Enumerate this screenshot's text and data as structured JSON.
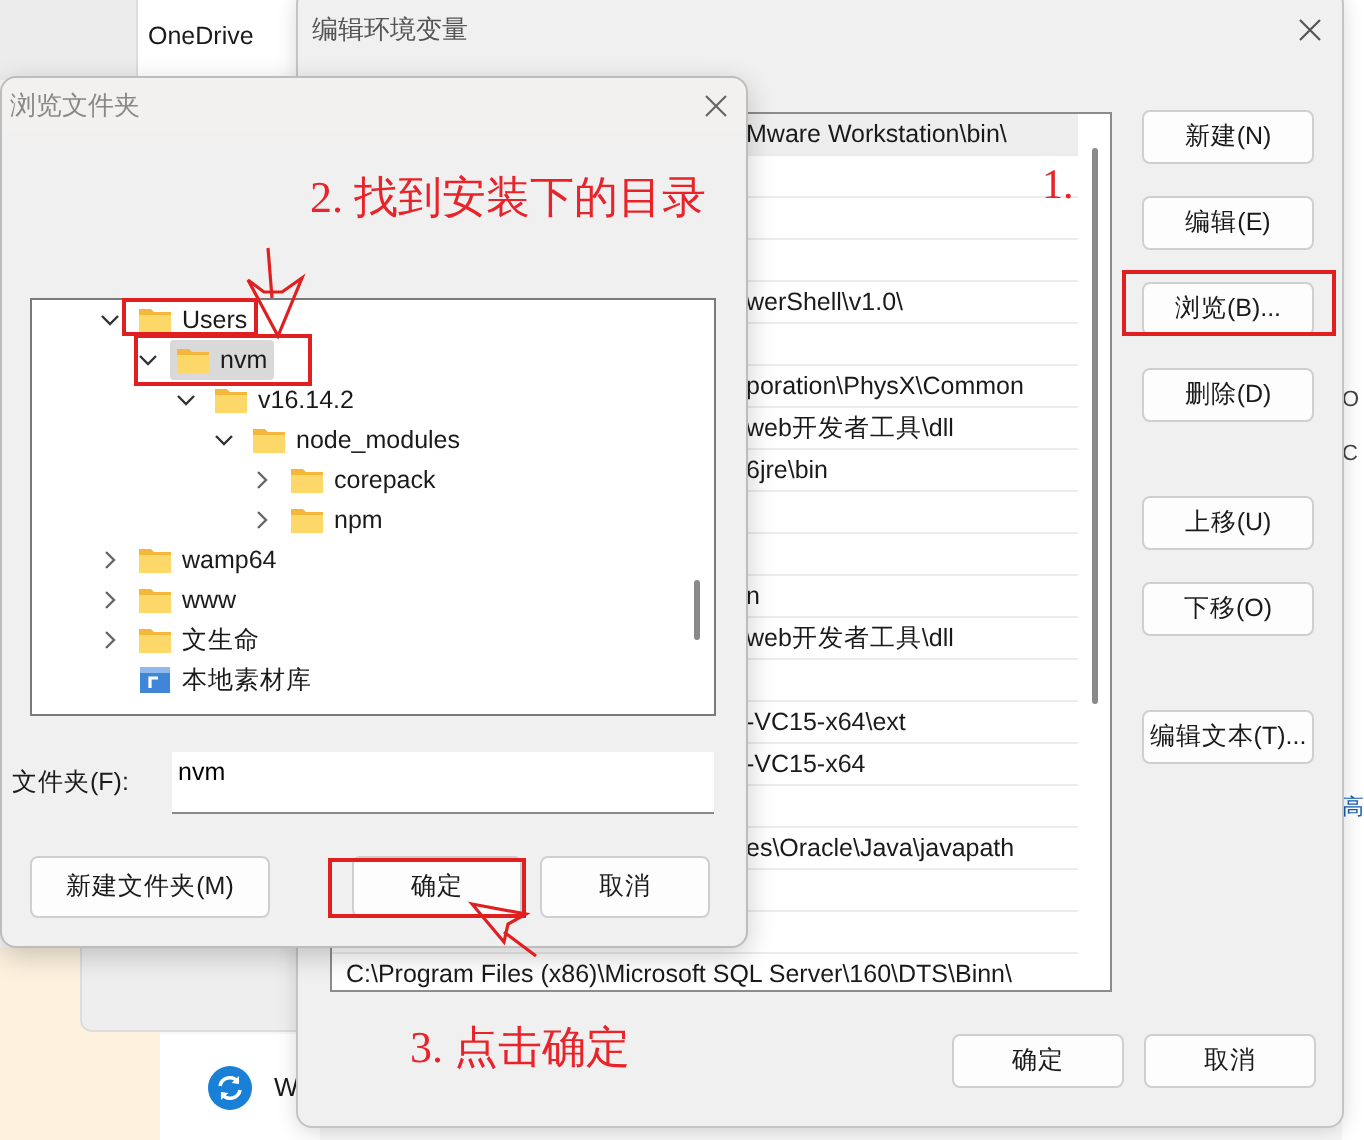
{
  "background": {
    "list_items": [
      "OneDrive"
    ],
    "edge_texts": [
      "O",
      "C",
      "高"
    ],
    "bottom_text": "W"
  },
  "env_dialog": {
    "title": "编辑环境变量",
    "rows": [
      {
        "kind": "covered",
        "text": "Mware Workstation\\bin\\",
        "selected": true
      },
      {
        "kind": "covered",
        "selected": false
      },
      {
        "kind": "covered",
        "selected": false
      },
      {
        "kind": "covered",
        "selected": false
      },
      {
        "kind": "covered",
        "text": "werShell\\v1.0\\",
        "selected": false
      },
      {
        "kind": "covered",
        "selected": false
      },
      {
        "kind": "covered",
        "text": "poration\\PhysX\\Common",
        "selected": false
      },
      {
        "kind": "covered",
        "text": "web开发者工具\\dll",
        "selected": false
      },
      {
        "kind": "covered",
        "text": "6jre\\bin",
        "selected": false
      },
      {
        "kind": "covered",
        "selected": false
      },
      {
        "kind": "covered",
        "selected": false
      },
      {
        "kind": "covered",
        "text": "n",
        "selected": false
      },
      {
        "kind": "covered",
        "text": "web开发者工具\\dll",
        "selected": false
      },
      {
        "kind": "covered",
        "selected": false
      },
      {
        "kind": "covered",
        "text": "-VC15-x64\\ext",
        "selected": false
      },
      {
        "kind": "covered",
        "text": "-VC15-x64",
        "selected": false
      },
      {
        "kind": "covered",
        "selected": false
      },
      {
        "kind": "covered",
        "text": "es\\Oracle\\Java\\javapath",
        "selected": false
      },
      {
        "kind": "covered",
        "selected": false
      },
      {
        "kind": "covered",
        "selected": false
      },
      {
        "kind": "full",
        "text": "C:\\Program Files (x86)\\Microsoft SQL Server\\160\\DTS\\Binn\\",
        "selected": false
      }
    ],
    "buttons": [
      [
        "新建(N)",
        "编辑(E)",
        "浏览(B)...",
        "删除(D)"
      ],
      [
        "上移(U)",
        "下移(O)"
      ],
      [
        "编辑文本(T)..."
      ]
    ],
    "footer_buttons": [
      "确定",
      "取消"
    ]
  },
  "folder_dialog": {
    "title": "浏览文件夹",
    "tree": [
      {
        "label": "Users",
        "kind": "folder",
        "expanded": true,
        "selected": false,
        "children": [
          {
            "label": "nvm",
            "kind": "folder",
            "expanded": true,
            "selected": true,
            "children": [
              {
                "label": "v16.14.2",
                "kind": "folder",
                "expanded": true,
                "selected": false,
                "children": [
                  {
                    "label": "node_modules",
                    "kind": "folder",
                    "expanded": true,
                    "selected": false,
                    "children": [
                      {
                        "label": "corepack",
                        "kind": "folder",
                        "expanded": false,
                        "selected": false
                      },
                      {
                        "label": "npm",
                        "kind": "folder",
                        "expanded": false,
                        "selected": false
                      }
                    ]
                  }
                ]
              }
            ]
          }
        ]
      },
      {
        "label": "wamp64",
        "kind": "folder",
        "expanded": false,
        "selected": false
      },
      {
        "label": "www",
        "kind": "folder",
        "expanded": false,
        "selected": false
      },
      {
        "label": "文生命",
        "kind": "folder",
        "expanded": false,
        "selected": false
      },
      {
        "label": "本地素材库",
        "kind": "library",
        "selected": false
      }
    ],
    "folder_label": "文件夹(F):",
    "folder_value": "nvm",
    "buttons": [
      "新建文件夹(M)",
      "确定",
      "取消"
    ]
  },
  "annotations": [
    {
      "text": "1."
    },
    {
      "text": "2. 找到安装下的目录"
    },
    {
      "text": "3. 点击确定"
    }
  ]
}
